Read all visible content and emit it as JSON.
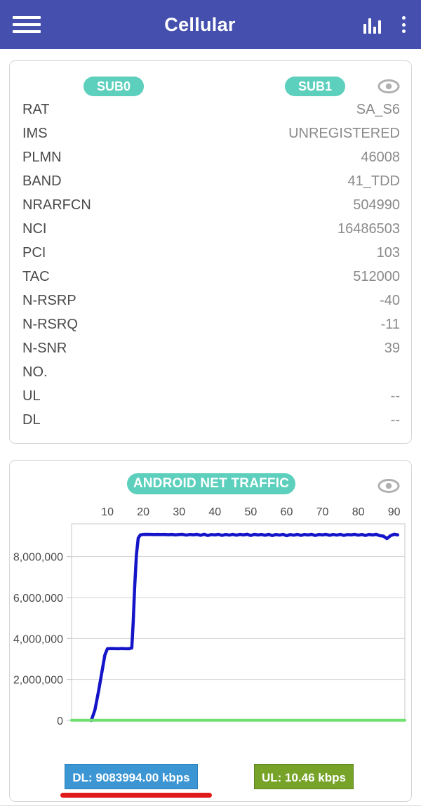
{
  "appbar": {
    "title": "Cellular",
    "menu_icon": "hamburger-icon",
    "chart_icon": "bar-chart-icon",
    "overflow_icon": "more-vertical-icon",
    "background": "#4550AE"
  },
  "info_card": {
    "chip_sub0": "SUB0",
    "chip_sub1": "SUB1",
    "chip_color": "#5CCFBD",
    "eye_icon": "eye-icon",
    "rows": [
      {
        "key": "RAT",
        "value": "SA_S6"
      },
      {
        "key": "IMS",
        "value": "UNREGISTERED"
      },
      {
        "key": "PLMN",
        "value": "46008"
      },
      {
        "key": "BAND",
        "value": "41_TDD"
      },
      {
        "key": "NRARFCN",
        "value": "504990"
      },
      {
        "key": "NCI",
        "value": "16486503"
      },
      {
        "key": "PCI",
        "value": "103"
      },
      {
        "key": "TAC",
        "value": "512000"
      },
      {
        "key": "N-RSRP",
        "value": "-40"
      },
      {
        "key": "N-RSRQ",
        "value": "-11"
      },
      {
        "key": "N-SNR",
        "value": "39"
      },
      {
        "key": "NO.",
        "value": ""
      },
      {
        "key": "UL",
        "value": "--"
      },
      {
        "key": "DL",
        "value": "--"
      }
    ]
  },
  "chart_card": {
    "chip_title": "ANDROID NET TRAFFIC",
    "eye_icon": "eye-icon"
  },
  "footer": {
    "dl_badge": "DL: 9083994.00 kbps",
    "ul_badge": "UL: 10.46 kbps",
    "dl_color": "#3D96D4",
    "ul_color": "#76A328",
    "underline_color": "#E01B1B"
  },
  "chart_data": {
    "type": "line",
    "title": "ANDROID NET TRAFFIC",
    "xlabel": "",
    "ylabel": "",
    "xlim": [
      0,
      93
    ],
    "ylim": [
      0,
      9600000
    ],
    "xticks": [
      10,
      20,
      30,
      40,
      50,
      60,
      70,
      80,
      90
    ],
    "yticks": [
      0,
      2000000,
      4000000,
      6000000,
      8000000
    ],
    "ytick_labels": [
      "0",
      "2,000,000",
      "4,000,000",
      "6,000,000",
      "8,000,000"
    ],
    "grid": true,
    "xaxis_position": "top",
    "legend": "none",
    "series": [
      {
        "name": "DL",
        "color": "#1414C8",
        "x": [
          5.5,
          6.5,
          7.5,
          8.5,
          9.3,
          10.0,
          11,
          12,
          13,
          14,
          15,
          16,
          16.8,
          17.2,
          17.6,
          18.1,
          18.6,
          19.2,
          20,
          21,
          22,
          23,
          24,
          25,
          26,
          27,
          28,
          29,
          30,
          31,
          32,
          33,
          34,
          35,
          36,
          37,
          38,
          39,
          40,
          41,
          42,
          43,
          44,
          45,
          46,
          47,
          48,
          49,
          50,
          51,
          52,
          53,
          54,
          55,
          56,
          57,
          58,
          59,
          60,
          61,
          62,
          63,
          64,
          65,
          66,
          67,
          68,
          69,
          70,
          71,
          72,
          73,
          74,
          75,
          76,
          77,
          78,
          79,
          80,
          81,
          82,
          83,
          84,
          85,
          86,
          87,
          88,
          89,
          90,
          91
        ],
        "y": [
          0,
          500000,
          1400000,
          2400000,
          3200000,
          3500000,
          3510000,
          3505000,
          3500000,
          3508000,
          3502000,
          3500000,
          3540000,
          4800000,
          6500000,
          8100000,
          8900000,
          9060000,
          9080000,
          9085000,
          9080000,
          9075000,
          9082000,
          9078000,
          9083000,
          9070000,
          9082000,
          9060000,
          9078000,
          9085000,
          9050000,
          9080000,
          9065000,
          9085000,
          9040000,
          9090000,
          9030000,
          9075000,
          9060000,
          9085000,
          9035000,
          9080000,
          9050000,
          9085000,
          9045000,
          9082000,
          9060000,
          9090000,
          9030000,
          9085000,
          9055000,
          9080000,
          9040000,
          9085000,
          9025000,
          9080000,
          9050000,
          9085000,
          9020000,
          9075000,
          9045000,
          9085000,
          9035000,
          9080000,
          9055000,
          9085000,
          9030000,
          9078000,
          9060000,
          9085000,
          9040000,
          9080000,
          9050000,
          9085000,
          9035000,
          9075000,
          9060000,
          9085000,
          9045000,
          9080000,
          9030000,
          9082000,
          9055000,
          9085000,
          9020000,
          9000000,
          8880000,
          9020000,
          9090000,
          9060000
        ]
      },
      {
        "name": "UL",
        "color": "#70E070",
        "x": [
          0,
          93
        ],
        "y": [
          10460,
          10460
        ]
      }
    ]
  }
}
